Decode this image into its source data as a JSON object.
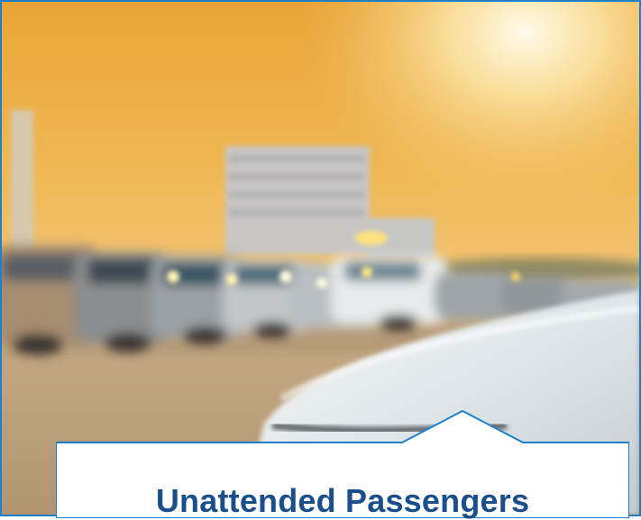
{
  "callout": {
    "title": "Unattended Passengers"
  },
  "colors": {
    "frame_border": "#1f7fc9",
    "title_text": "#1a4f8b",
    "callout_bg": "#ffffff"
  },
  "image": {
    "subject": "blurred parking lot with cars at sunset",
    "icon_name": "photo"
  }
}
